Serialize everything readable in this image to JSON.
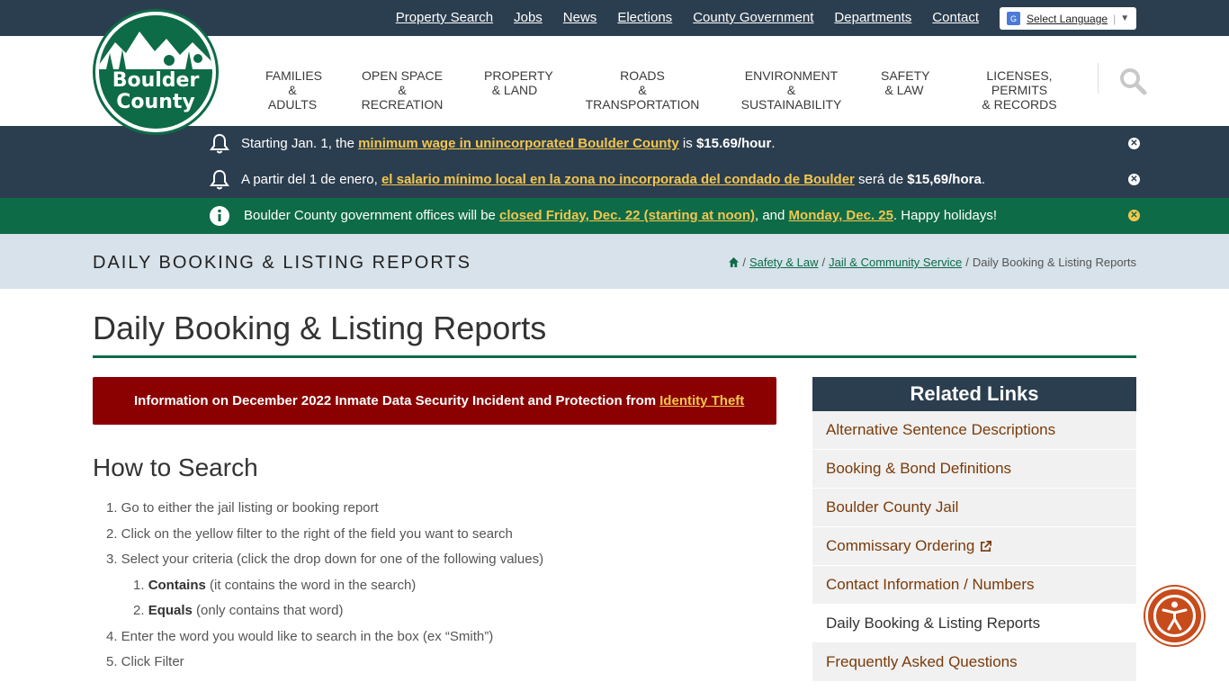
{
  "top_nav": {
    "links": [
      "Property Search",
      "Jobs",
      "News",
      "Elections",
      "County Government",
      "Departments",
      "Contact"
    ],
    "language_label": "Select Language"
  },
  "logo": {
    "line1": "Boulder",
    "line2": "County"
  },
  "main_nav": {
    "items": [
      {
        "line1": "FAMILIES",
        "line2": "& ADULTS"
      },
      {
        "line1": "OPEN SPACE",
        "line2": "& RECREATION"
      },
      {
        "line1": "PROPERTY",
        "line2": "& LAND"
      },
      {
        "line1": "ROADS",
        "line2": "& TRANSPORTATION"
      },
      {
        "line1": "ENVIRONMENT",
        "line2": "& SUSTAINABILITY"
      },
      {
        "line1": "SAFETY",
        "line2": "& LAW"
      },
      {
        "line1": "LICENSES, PERMITS",
        "line2": "& RECORDS"
      }
    ]
  },
  "alerts": [
    {
      "pre": "Starting Jan. 1, the ",
      "link": "minimum wage in unincorporated Boulder County",
      "mid": " is ",
      "bold": "$15.69/hour",
      "post": "."
    },
    {
      "pre": "A partir del 1 de enero, ",
      "link": "el salario mínimo local en la zona no incorporada del condado de Boulder",
      "mid": " será de ",
      "bold": "$15,69/hora",
      "post": "."
    },
    {
      "pre": "Boulder County government offices will be ",
      "link": "closed Friday, Dec. 22 (starting at noon)",
      "mid": ", and ",
      "link2": "Monday, Dec. 25",
      "post": ". Happy holidays!"
    }
  ],
  "title_band": {
    "heading": "DAILY BOOKING & LISTING REPORTS",
    "breadcrumbs": [
      "Safety & Law",
      "Jail & Community Service"
    ],
    "current": "Daily Booking & Listing Reports"
  },
  "page_title": "Daily Booking & Listing Reports",
  "notice": {
    "text": "Information on December 2022 Inmate Data Security Incident and Protection from",
    "link": "Identity Theft"
  },
  "how_to": {
    "heading": "How to Search",
    "steps": [
      "1. Go to either the jail listing or booking report",
      "2. Click on the yellow filter to the right of the field you want to search",
      "3. Select your criteria (click the drop down for one of the following values)"
    ],
    "sub_steps": [
      {
        "num": "1. ",
        "bold": "Contains",
        "rest": " (it contains the word in the search)"
      },
      {
        "num": "2. ",
        "bold": "Equals",
        "rest": " (only contains that word)"
      }
    ],
    "steps_after": [
      "4. Enter the word you would like to search in the box (ex “Smith”)",
      "5. Click Filter"
    ]
  },
  "related_links": {
    "heading": "Related Links",
    "items": [
      "Alternative Sentence Descriptions",
      "Booking & Bond Definitions",
      "Boulder County Jail",
      "Commissary Ordering",
      "Contact Information / Numbers",
      "Daily Booking & Listing Reports",
      "Frequently Asked Questions"
    ]
  },
  "colors": {
    "navy": "#2b3e4f",
    "green": "#0e6b47",
    "gold": "#f3c64d",
    "notice_red": "#8b0000",
    "link_brown": "#7a3b0b"
  }
}
